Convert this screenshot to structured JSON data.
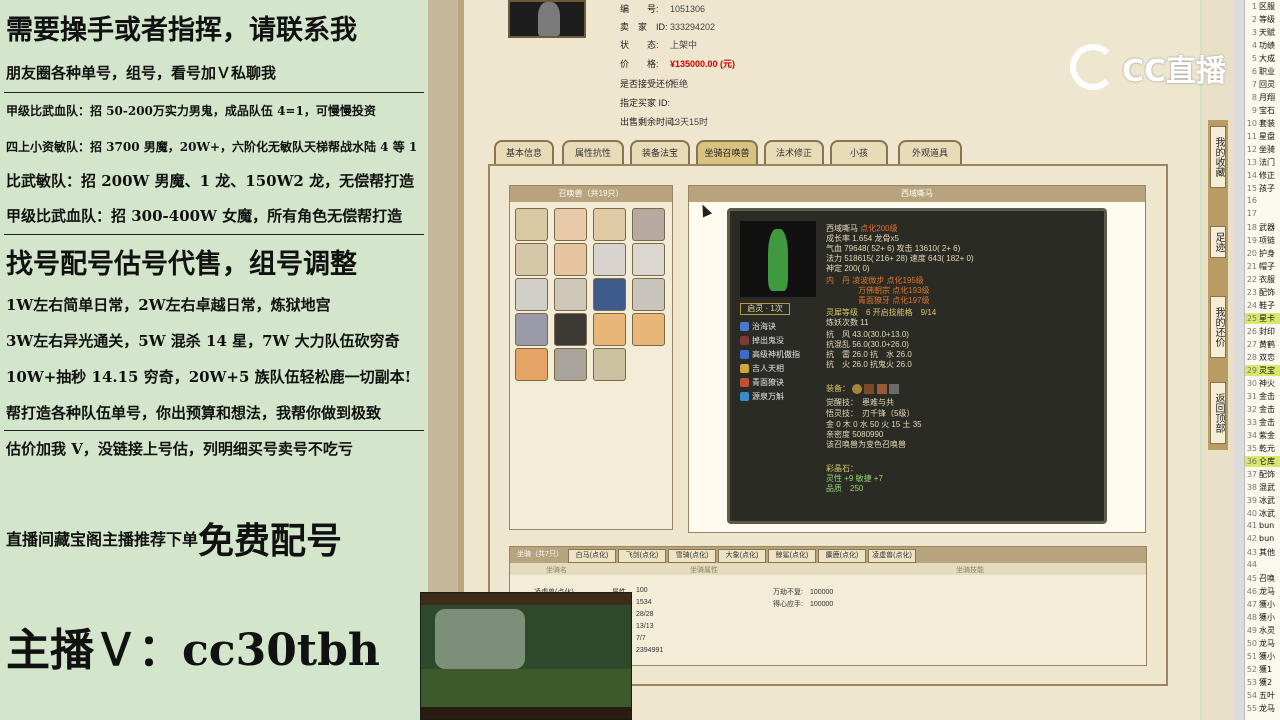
{
  "promo": {
    "line1": "需要操手或者指挥，请联系我",
    "line2": "朋友圈各种单号，组号，看号加Ｖ私聊我",
    "line3": "甲级比武血队：招 50-200万实力男鬼，成品队伍 4=1，可慢慢投资",
    "line4": "四上小资敏队：招 3700 男魔，20W+，六阶化无敏队天梯帮战水陆 4 等 1",
    "line5": "比武敏队：招 200W 男魔、1 龙、150W2 龙，无偿帮打造",
    "line6": "甲级比武血队：招 300-400W 女魔，所有角色无偿帮打造",
    "line7": "找号配号估号代售，组号调整",
    "line8": "1W左右简单日常，2W左右卓越日常，炼狱地宫",
    "line9": "3W左右异光通关，5W 混杀 14 星，7W 大力队伍砍穷奇",
    "line10": "10W+抽秒 14.15 穷奇，20W+5 族队伍轻松鹿一切副本!",
    "line11": "帮打造各种队伍单号，你出预算和想法，我帮你做到极致",
    "line12": "估价加我 V，没链接上号估，列明细买号卖号不吃亏",
    "free_prefix": "直播间藏宝阁主播推荐下单",
    "free_big": "免费配号",
    "anchor": "主播Ｖ：cc30tbh"
  },
  "listing": {
    "rows": [
      {
        "k": "编　　号:",
        "v": "1051306"
      },
      {
        "k": "卖　家　ID:",
        "v": "333294202"
      },
      {
        "k": "状　　态:",
        "v": "上架中"
      },
      {
        "k": "价　　格:",
        "v": "¥135000.00 (元)"
      },
      {
        "k": "是否接受还价:",
        "v": "拒绝"
      },
      {
        "k": "指定买家 ID:",
        "v": ""
      },
      {
        "k": "出售剩余时间:",
        "v": "13天15时"
      }
    ]
  },
  "tabs": [
    "基本信息",
    "属性抗性",
    "装备法宝",
    "坐骑召唤兽",
    "法术修正",
    "小孩",
    "外观道具"
  ],
  "pets_title": "召唤兽（共19只）",
  "detail_title": "西域嘶马",
  "card": {
    "name": "西域嘶马",
    "level": "点化200级",
    "growth": "成长率 1.654 龙骨x5",
    "hp": "气血 79648( 52+ 6) 攻击 13610( 2+ 6)",
    "mp": "法力 518615( 216+ 28) 速度 643( 182+ 0)",
    "loyal": "神定 200( 0)",
    "neidan1": "内　丹 凌波微步 点化195级",
    "neidan2": "万佛朝宗 点化193级",
    "neidan3": "青面獠牙 点化197级",
    "spirit": "灵犀等级　6 开启技能格　9/14",
    "practice": "炼妖次数 11",
    "res1": "抗　风 43.0(30.0+13.0)",
    "res2": "抗混乱 56.0(30.0+26.0)",
    "res3": "抗　雷 26.0 抗　水 26.0",
    "res4": "抗　火 26.0 抗鬼火 26.0",
    "equip": "装备：",
    "awake": "觉醒技：　患难与共",
    "realm": "悟灵技：　刃千锋（5级）",
    "elements": "金 0 木 0 水 50 火 15 土 35",
    "intimacy": "亲密度 5080990",
    "note": "该召唤兽为变色召唤兽",
    "stone": "彩晶石：",
    "stone1": "灵性 +9 敏捷 +7",
    "stone2": "品质　250",
    "badge": "启灵 · 1次",
    "skills": [
      "治海诀",
      "掉出鬼没",
      "高级神机傲指",
      "吉人天相",
      "青面獠诀",
      "源泉万斛"
    ]
  },
  "mount": {
    "title": "坐骑（共7只）",
    "tabs": [
      "白马(点化)",
      "飞剑(点化)",
      "雪骑(点化)",
      "大象(点化)",
      "鲸鲨(点化)",
      "麋鹿(点化)",
      "凌虚兽(点化)"
    ],
    "sub": [
      "坐骑名",
      "坐骑属性",
      "坐骑技能"
    ],
    "name": "凌虚兽(点化)",
    "label": "属性",
    "values": [
      "100",
      "1534",
      "28/28",
      "13/13",
      "7/7",
      "2394991"
    ],
    "skill1": "万劫不复:　100000",
    "skill2": "得心应手:　100000"
  },
  "sidebar": {
    "buttons": [
      "我的收藏",
      "足迹",
      "我的还价",
      "返回顶部"
    ]
  },
  "list": [
    {
      "n": "1",
      "t": "区服"
    },
    {
      "n": "2",
      "t": "等级"
    },
    {
      "n": "3",
      "t": "天赋"
    },
    {
      "n": "4",
      "t": "功绩"
    },
    {
      "n": "5",
      "t": "大成"
    },
    {
      "n": "6",
      "t": "职业"
    },
    {
      "n": "7",
      "t": "回灵"
    },
    {
      "n": "8",
      "t": "月翔"
    },
    {
      "n": "9",
      "t": "宝石"
    },
    {
      "n": "10",
      "t": "套装"
    },
    {
      "n": "11",
      "t": "星盘"
    },
    {
      "n": "12",
      "t": "坐骑"
    },
    {
      "n": "13",
      "t": "法门"
    },
    {
      "n": "14",
      "t": "修正"
    },
    {
      "n": "15",
      "t": "孩子"
    },
    {
      "n": "16",
      "t": ""
    },
    {
      "n": "17",
      "t": ""
    },
    {
      "n": "18",
      "t": "武器"
    },
    {
      "n": "19",
      "t": "项链"
    },
    {
      "n": "20",
      "t": "护身"
    },
    {
      "n": "21",
      "t": "帽子"
    },
    {
      "n": "22",
      "t": "衣服"
    },
    {
      "n": "23",
      "t": "配饰"
    },
    {
      "n": "24",
      "t": "鞋子"
    },
    {
      "n": "25",
      "t": "星卡"
    },
    {
      "n": "26",
      "t": "封印"
    },
    {
      "n": "27",
      "t": "黄鹤"
    },
    {
      "n": "28",
      "t": "双恋"
    },
    {
      "n": "29",
      "t": "灵宝"
    },
    {
      "n": "30",
      "t": "神火"
    },
    {
      "n": "31",
      "t": "金击"
    },
    {
      "n": "32",
      "t": "金击"
    },
    {
      "n": "33",
      "t": "金击"
    },
    {
      "n": "34",
      "t": "紫金"
    },
    {
      "n": "35",
      "t": "乾元"
    },
    {
      "n": "36",
      "t": "仑库"
    },
    {
      "n": "37",
      "t": "配饰"
    },
    {
      "n": "38",
      "t": "混武"
    },
    {
      "n": "39",
      "t": "冰武"
    },
    {
      "n": "40",
      "t": "冰武"
    },
    {
      "n": "41",
      "t": "bun"
    },
    {
      "n": "42",
      "t": "bun"
    },
    {
      "n": "43",
      "t": "其他"
    },
    {
      "n": "44",
      "t": ""
    },
    {
      "n": "45",
      "t": "召唤"
    },
    {
      "n": "46",
      "t": "龙马"
    },
    {
      "n": "47",
      "t": "獲小"
    },
    {
      "n": "48",
      "t": "獲小"
    },
    {
      "n": "49",
      "t": "水灵"
    },
    {
      "n": "50",
      "t": "龙马"
    },
    {
      "n": "51",
      "t": "獲小"
    },
    {
      "n": "52",
      "t": "獲1"
    },
    {
      "n": "53",
      "t": "獲2"
    },
    {
      "n": "54",
      "t": "五叶"
    },
    {
      "n": "55",
      "t": "龙马"
    }
  ],
  "logo_text": "CC直播",
  "colors": {
    "bg_left": "#d3e6cb",
    "page": "#efe6cf",
    "price": "#cc0000",
    "highlight": "#d6e96c"
  }
}
